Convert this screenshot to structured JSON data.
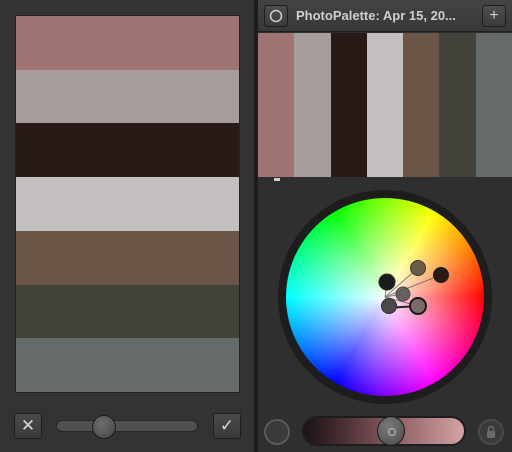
{
  "left": {
    "palette": [
      {
        "color": "#a07473"
      },
      {
        "color": "#a69c9b"
      },
      {
        "color": "#2a1a17"
      },
      {
        "color": "#c3bfbf"
      },
      {
        "color": "#6a5546"
      },
      {
        "color": "#42423a"
      },
      {
        "color": "#656b6b"
      }
    ],
    "cancel_icon": "close-icon",
    "cancel_label": "✕",
    "confirm_icon": "checkmark-icon",
    "confirm_label": "✓",
    "slider_value": 0.3
  },
  "right": {
    "header": {
      "title": "PhotoPalette: Apr 15, 20...",
      "history_icon": "circle-arrow-icon",
      "add_label": "+"
    },
    "palette": [
      {
        "color": "#a07473"
      },
      {
        "color": "#a69c9b"
      },
      {
        "color": "#2a1a17"
      },
      {
        "color": "#c3bfbf"
      },
      {
        "color": "#6a5546"
      },
      {
        "color": "#42423a"
      },
      {
        "color": "#656b6b"
      }
    ],
    "wheel_points": [
      {
        "color": "#1c1c1c"
      },
      {
        "color": "#6b5b4b"
      },
      {
        "color": "#2a1a17"
      },
      {
        "color": "#4a4a4a"
      },
      {
        "color": "#565656"
      },
      {
        "color": "#7a6a68"
      }
    ],
    "brightness_slider": {
      "value": 0.55,
      "gradient_start": "#1a1416",
      "gradient_end": "#d4a2a4"
    },
    "lock_icon": "lock-icon"
  }
}
